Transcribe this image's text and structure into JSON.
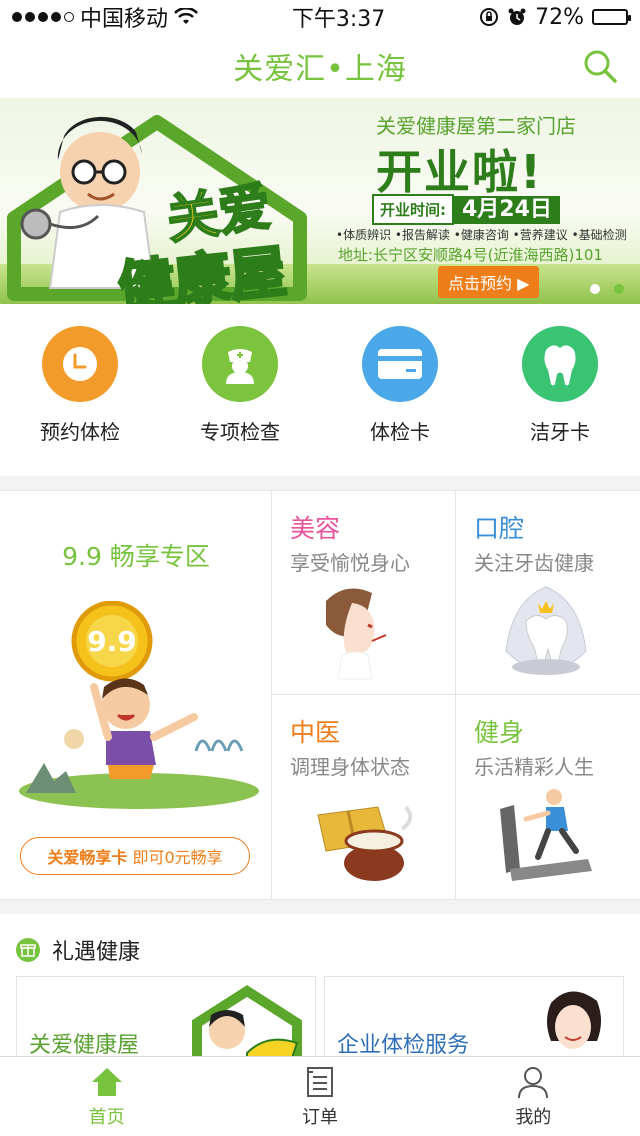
{
  "status_bar": {
    "carrier": "中国移动",
    "time": "下午3:37",
    "battery": "72%",
    "battery_level": 0.72
  },
  "header": {
    "title": "关爱汇•上海",
    "search_icon": "search-icon"
  },
  "banner": {
    "subtitle": "关爱健康屋第二家门店",
    "headline": "开业啦!",
    "time_label": "开业时间:",
    "date": "4月24日",
    "features": "•体质辨识 •报告解读 •健康咨询 •营养建议 •基础检测",
    "address": "地址:长宁区安顺路4号(近淮海西路)101",
    "cta": "点击预约",
    "brand_line1": "关爱",
    "brand_line2": "健康屋",
    "page_count": 2,
    "active_page": 2
  },
  "quick_menu": [
    {
      "label": "预约体检",
      "icon": "clock-icon",
      "color": "#f39b2a"
    },
    {
      "label": "专项检查",
      "icon": "nurse-icon",
      "color": "#7cc43d"
    },
    {
      "label": "体检卡",
      "icon": "card-icon",
      "color": "#4aa8e8"
    },
    {
      "label": "洁牙卡",
      "icon": "tooth-icon",
      "color": "#39c373"
    }
  ],
  "promo": {
    "zone_title": "9.9 畅享专区",
    "coin_text": "9.9",
    "zone_button_prefix": "关爱畅享卡",
    "zone_button_text": "即可0元畅享",
    "cells": [
      {
        "title": "美容",
        "subtitle": "享受愉悦身心",
        "color": "#e8539b",
        "icon": "beauty-icon"
      },
      {
        "title": "口腔",
        "subtitle": "关注牙齿健康",
        "color": "#3a8fd6",
        "icon": "tooth-crown-icon"
      },
      {
        "title": "中医",
        "subtitle": "调理身体状态",
        "color": "#ee7e1a",
        "icon": "herb-pot-icon"
      },
      {
        "title": "健身",
        "subtitle": "乐活精彩人生",
        "color": "#78c33e",
        "icon": "treadmill-icon"
      }
    ]
  },
  "gift": {
    "title": "礼遇健康",
    "cards": [
      {
        "title": "关爱健康屋",
        "color": "#5aa231"
      },
      {
        "title": "企业体检服务",
        "color": "#2f6fb7"
      }
    ]
  },
  "tab_bar": [
    {
      "label": "首页",
      "icon": "home-icon",
      "active": true
    },
    {
      "label": "订单",
      "icon": "order-icon",
      "active": false
    },
    {
      "label": "我的",
      "icon": "profile-icon",
      "active": false
    }
  ],
  "colors": {
    "brand_green": "#78c33e",
    "accent_orange": "#ee7e1a"
  }
}
